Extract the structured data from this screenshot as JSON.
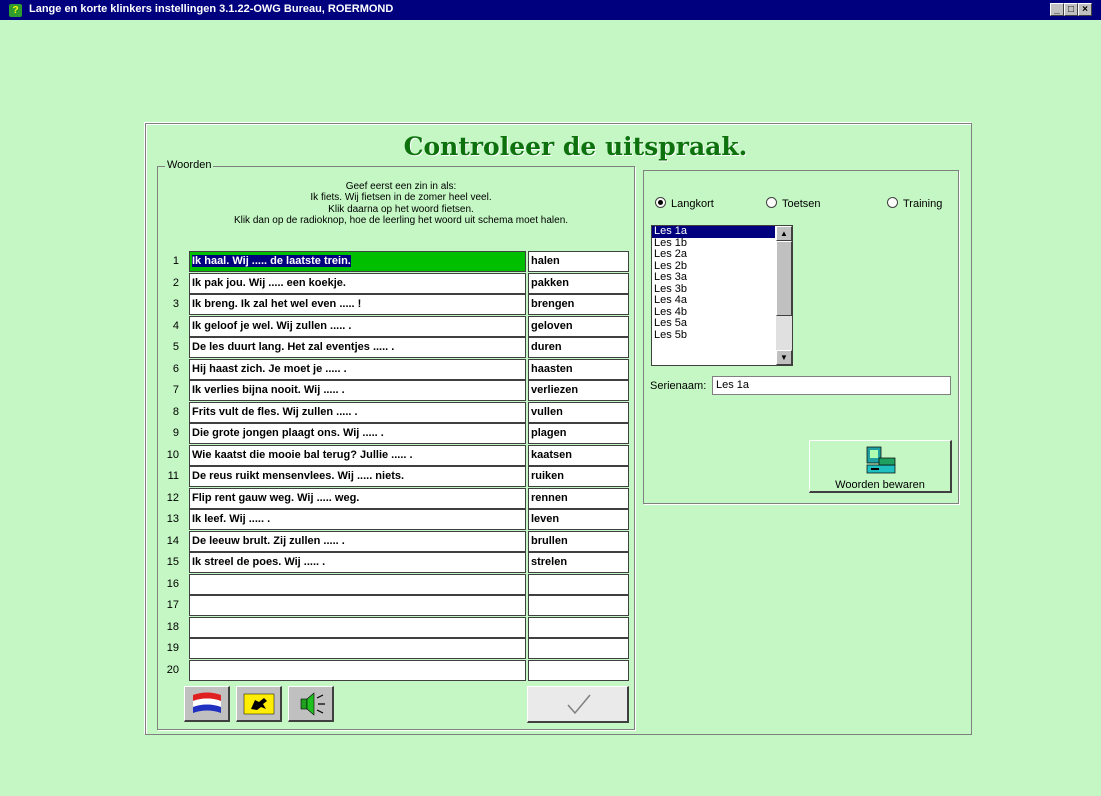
{
  "window": {
    "title": "Lange en korte klinkers instellingen  3.1.22-OWG Bureau, ROERMOND",
    "controls": {
      "minimize": "_",
      "maximize": "□",
      "close": "×"
    }
  },
  "heading": "Controleer de uitspraak.",
  "words_group": {
    "label": "Woorden",
    "instructions": [
      "Geef eerst een zin in als:",
      "Ik fiets. Wij fietsen in de zomer heel veel.",
      "Klik daarna op het woord fietsen.",
      "Klik dan op de radioknop, hoe de leerling het woord uit schema moet halen."
    ],
    "rows": [
      {
        "num": "1",
        "sentence": "Ik haal. Wij ..... de laatste trein.",
        "word": "halen"
      },
      {
        "num": "2",
        "sentence": "Ik pak jou. Wij ..... een koekje.",
        "word": "pakken"
      },
      {
        "num": "3",
        "sentence": "Ik breng. Ik zal het wel even ..... !",
        "word": "brengen"
      },
      {
        "num": "4",
        "sentence": "Ik geloof je wel. Wij zullen ..... .",
        "word": "geloven"
      },
      {
        "num": "5",
        "sentence": "De les duurt lang. Het zal eventjes ..... .",
        "word": "duren"
      },
      {
        "num": "6",
        "sentence": "Hij haast zich. Je moet je ..... .",
        "word": "haasten"
      },
      {
        "num": "7",
        "sentence": "Ik verlies bijna nooit. Wij ..... .",
        "word": "verliezen"
      },
      {
        "num": "8",
        "sentence": "Frits vult de fles. Wij zullen ..... .",
        "word": "vullen"
      },
      {
        "num": "9",
        "sentence": "Die grote jongen plaagt ons. Wij ..... .",
        "word": "plagen"
      },
      {
        "num": "10",
        "sentence": "Wie kaatst die mooie bal terug? Jullie ..... .",
        "word": "kaatsen"
      },
      {
        "num": "11",
        "sentence": "De reus ruikt mensenvlees. Wij ..... niets.",
        "word": "ruiken"
      },
      {
        "num": "12",
        "sentence": "Flip rent gauw weg. Wij ..... weg.",
        "word": "rennen"
      },
      {
        "num": "13",
        "sentence": "Ik leef. Wij ..... .",
        "word": "leven"
      },
      {
        "num": "14",
        "sentence": "De leeuw brult. Zij zullen ..... .",
        "word": "brullen"
      },
      {
        "num": "15",
        "sentence": "Ik streel de poes. Wij ..... .",
        "word": "strelen"
      },
      {
        "num": "16",
        "sentence": "",
        "word": ""
      },
      {
        "num": "17",
        "sentence": "",
        "word": ""
      },
      {
        "num": "18",
        "sentence": "",
        "word": ""
      },
      {
        "num": "19",
        "sentence": "",
        "word": ""
      },
      {
        "num": "20",
        "sentence": "",
        "word": ""
      }
    ],
    "toolbar": {
      "buttons": [
        "dutch-flag-icon",
        "flemish-lion-flag-icon",
        "speaker-icon"
      ],
      "confirm_icon": "checkmark-icon"
    }
  },
  "options": {
    "radios": [
      {
        "label": "Langkort",
        "checked": true
      },
      {
        "label": "Toetsen",
        "checked": false
      },
      {
        "label": "Training",
        "checked": false
      }
    ],
    "lessons": [
      "Les 1a",
      "Les 1b",
      "Les 2a",
      "Les 2b",
      "Les 3a",
      "Les 3b",
      "Les 4a",
      "Les 4b",
      "Les 5a",
      "Les 5b"
    ],
    "selected_lesson": "Les 1a",
    "serie_label": "Serienaam:",
    "serie_value": "Les 1a",
    "save_label": "Woorden bewaren",
    "save_icon": "computer-save-icon"
  },
  "colors": {
    "background": "#c4f7c4",
    "titlebar": "#00007e",
    "heading": "#0d720d",
    "highlight": "#00bf00",
    "selection": "#00007e"
  }
}
